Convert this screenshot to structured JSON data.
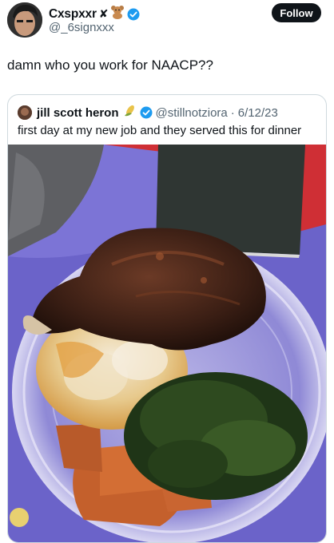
{
  "post": {
    "display_name": "Cxspxxr",
    "handle": "@_6signxxx",
    "follow_label": "Follow",
    "text": "damn who you work for NAACP??"
  },
  "quote": {
    "display_name": "jill scott heron",
    "handle": "@stillnotziora",
    "separator": "·",
    "date": "6/12/23",
    "text": "first day at my new job and they served this for dinner"
  },
  "colors": {
    "verified": "#1d9bf0",
    "follow_bg": "#0f1419",
    "secondary_text": "#536471"
  },
  "icons": [
    "verified-badge-icon",
    "x-mark-icon",
    "teddy-bear-icon",
    "corn-icon"
  ]
}
